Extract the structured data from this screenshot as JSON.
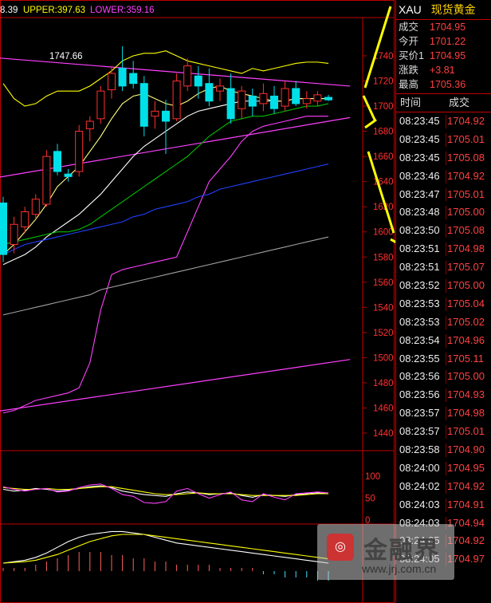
{
  "legend": {
    "mid_fragment": "8.39",
    "upper": "UPPER:397.63",
    "lower": "LOWER:359.16",
    "colors": {
      "mid": "#ffffff",
      "upper": "#ffff00",
      "lower": "#ff40ff"
    }
  },
  "annotation_high": "1747.66",
  "quote": {
    "symbol": "XAU",
    "name": "现货黄金",
    "rows": [
      {
        "label": "成交",
        "value": "1704.95",
        "color": "#ff4040"
      },
      {
        "label": "今开",
        "value": "1701.22",
        "color": "#ff4040"
      },
      {
        "label": "买价1",
        "value": "1704.95",
        "color": "#ff4040"
      },
      {
        "label": "涨跌",
        "value": "+3.81",
        "color": "#ff4040"
      },
      {
        "label": "最高",
        "value": "1705.36",
        "color": "#ff4040"
      }
    ],
    "trades_header": {
      "time": "时间",
      "price": "成交"
    },
    "trades": [
      {
        "time": "08:23:45",
        "price": "1704.92"
      },
      {
        "time": "08:23:45",
        "price": "1705.01"
      },
      {
        "time": "08:23:45",
        "price": "1705.08"
      },
      {
        "time": "08:23:46",
        "price": "1704.92"
      },
      {
        "time": "08:23:47",
        "price": "1705.01"
      },
      {
        "time": "08:23:48",
        "price": "1705.00"
      },
      {
        "time": "08:23:50",
        "price": "1705.08"
      },
      {
        "time": "08:23:51",
        "price": "1704.98"
      },
      {
        "time": "08:23:51",
        "price": "1705.07"
      },
      {
        "time": "08:23:52",
        "price": "1705.00"
      },
      {
        "time": "08:23:53",
        "price": "1705.04"
      },
      {
        "time": "08:23:53",
        "price": "1705.02"
      },
      {
        "time": "08:23:54",
        "price": "1704.96"
      },
      {
        "time": "08:23:55",
        "price": "1705.11"
      },
      {
        "time": "08:23:56",
        "price": "1705.00"
      },
      {
        "time": "08:23:56",
        "price": "1704.93"
      },
      {
        "time": "08:23:57",
        "price": "1704.98"
      },
      {
        "time": "08:23:57",
        "price": "1705.01"
      },
      {
        "time": "08:23:58",
        "price": "1704.90"
      },
      {
        "time": "08:24:00",
        "price": "1704.95"
      },
      {
        "time": "08:24:02",
        "price": "1704.92"
      },
      {
        "time": "08:24:03",
        "price": "1704.91"
      },
      {
        "time": "08:24:03",
        "price": "1704.94"
      },
      {
        "time": "08:24:05",
        "price": "1704.92"
      },
      {
        "time": "08:24:05",
        "price": "1704.97"
      }
    ]
  },
  "watermark": {
    "logo_text": "金融界",
    "url": "www.jrj.com.cn"
  },
  "chart_data": [
    {
      "type": "candlestick",
      "ylim": [
        1425,
        1745
      ],
      "yticks": [
        "1740",
        "1720",
        "1700",
        "1680",
        "1660",
        "1640",
        "1620",
        "1600",
        "1580",
        "1560",
        "1540",
        "1520",
        "1500",
        "1480",
        "1460",
        "1440"
      ],
      "grid": false,
      "candles": [
        {
          "o": 1623,
          "h": 1628,
          "l": 1576,
          "c": 1582
        },
        {
          "o": 1590,
          "h": 1612,
          "l": 1583,
          "c": 1606
        },
        {
          "o": 1604,
          "h": 1620,
          "l": 1599,
          "c": 1616
        },
        {
          "o": 1614,
          "h": 1630,
          "l": 1610,
          "c": 1626
        },
        {
          "o": 1622,
          "h": 1665,
          "l": 1620,
          "c": 1660
        },
        {
          "o": 1664,
          "h": 1670,
          "l": 1645,
          "c": 1648
        },
        {
          "o": 1646,
          "h": 1650,
          "l": 1640,
          "c": 1644
        },
        {
          "o": 1648,
          "h": 1685,
          "l": 1644,
          "c": 1680
        },
        {
          "o": 1682,
          "h": 1692,
          "l": 1672,
          "c": 1688
        },
        {
          "o": 1690,
          "h": 1716,
          "l": 1686,
          "c": 1712
        },
        {
          "o": 1713,
          "h": 1732,
          "l": 1706,
          "c": 1726
        },
        {
          "o": 1730,
          "h": 1747.66,
          "l": 1712,
          "c": 1716
        },
        {
          "o": 1726,
          "h": 1736,
          "l": 1714,
          "c": 1718
        },
        {
          "o": 1718,
          "h": 1724,
          "l": 1676,
          "c": 1684
        },
        {
          "o": 1692,
          "h": 1704,
          "l": 1682,
          "c": 1696
        },
        {
          "o": 1696,
          "h": 1705,
          "l": 1662,
          "c": 1688
        },
        {
          "o": 1690,
          "h": 1726,
          "l": 1688,
          "c": 1720
        },
        {
          "o": 1716,
          "h": 1738,
          "l": 1712,
          "c": 1732
        },
        {
          "o": 1724,
          "h": 1732,
          "l": 1706,
          "c": 1716
        },
        {
          "o": 1718,
          "h": 1730,
          "l": 1700,
          "c": 1704
        },
        {
          "o": 1712,
          "h": 1722,
          "l": 1704,
          "c": 1716
        },
        {
          "o": 1714,
          "h": 1726,
          "l": 1686,
          "c": 1690
        },
        {
          "o": 1698,
          "h": 1716,
          "l": 1690,
          "c": 1712
        },
        {
          "o": 1708,
          "h": 1714,
          "l": 1692,
          "c": 1700
        },
        {
          "o": 1702,
          "h": 1718,
          "l": 1696,
          "c": 1710
        },
        {
          "o": 1708,
          "h": 1716,
          "l": 1694,
          "c": 1698
        },
        {
          "o": 1700,
          "h": 1720,
          "l": 1696,
          "c": 1714
        },
        {
          "o": 1714,
          "h": 1720,
          "l": 1700,
          "c": 1702
        },
        {
          "o": 1702,
          "h": 1712,
          "l": 1698,
          "c": 1706
        },
        {
          "o": 1704,
          "h": 1712,
          "l": 1700,
          "c": 1709
        },
        {
          "o": 1707,
          "h": 1709,
          "l": 1704,
          "c": 1705
        }
      ],
      "overlays": [
        {
          "kind": "trendline",
          "color": "#ff40ff",
          "points": [
            [
              0,
              1738
            ],
            [
              29,
              1718
            ]
          ]
        },
        {
          "kind": "trendline",
          "color": "#ff40ff",
          "points": [
            [
              0,
              1644
            ],
            [
              30,
              1688
            ]
          ]
        },
        {
          "kind": "trendline",
          "color": "#ff40ff",
          "points": [
            [
              0,
              1458
            ],
            [
              30,
              1496
            ]
          ]
        },
        {
          "kind": "boll_upper",
          "color": "#ffff00",
          "values": [
            1718,
            1706,
            1700,
            1702,
            1708,
            1712,
            1712,
            1712,
            1716,
            1722,
            1728,
            1736,
            1740,
            1742,
            1742,
            1744,
            1740,
            1736,
            1734,
            1732,
            1730,
            1728,
            1726,
            1730,
            1728,
            1730,
            1732,
            1734,
            1735,
            1735,
            1734
          ]
        },
        {
          "kind": "boll_mid",
          "color": "#ffffff",
          "values": [
            1574,
            1578,
            1582,
            1588,
            1596,
            1602,
            1608,
            1614,
            1622,
            1630,
            1640,
            1650,
            1660,
            1668,
            1674,
            1680,
            1686,
            1692,
            1696,
            1698,
            1700,
            1702,
            1704,
            1704,
            1704,
            1704,
            1704,
            1706,
            1706,
            1706,
            1706
          ]
        },
        {
          "kind": "boll_lower",
          "color": "#ff40ff",
          "values": [
            1456,
            1458,
            1462,
            1466,
            1468,
            1470,
            1472,
            1476,
            1496,
            1538,
            1566,
            1570,
            1572,
            1574,
            1576,
            1578,
            1580,
            1600,
            1620,
            1640,
            1650,
            1660,
            1672,
            1680,
            1684,
            1686,
            1688,
            1690,
            1692,
            1692,
            1692
          ]
        },
        {
          "kind": "ma",
          "color": "#ffff80",
          "values": [
            1582,
            1590,
            1600,
            1610,
            1622,
            1636,
            1644,
            1652,
            1664,
            1676,
            1690,
            1702,
            1708,
            1710,
            1706,
            1702,
            1700,
            1704,
            1710,
            1714,
            1716,
            1712,
            1710,
            1708,
            1706,
            1704,
            1704,
            1706,
            1706,
            1706,
            1706
          ]
        },
        {
          "kind": "ma",
          "color": "#00c000",
          "values": [
            1590,
            1592,
            1594,
            1596,
            1598,
            1600,
            1600,
            1602,
            1606,
            1612,
            1618,
            1624,
            1630,
            1636,
            1642,
            1648,
            1654,
            1660,
            1668,
            1676,
            1682,
            1688,
            1690,
            1692,
            1692,
            1694,
            1696,
            1698,
            1700,
            1700,
            1702
          ]
        },
        {
          "kind": "ma",
          "color": "#2040ff",
          "values": [
            1582,
            1586,
            1590,
            1592,
            1594,
            1596,
            1598,
            1600,
            1602,
            1604,
            1606,
            1608,
            1612,
            1614,
            1618,
            1620,
            1622,
            1624,
            1628,
            1630,
            1634,
            1636,
            1638,
            1640,
            1642,
            1644,
            1646,
            1648,
            1650,
            1652,
            1654
          ]
        },
        {
          "kind": "ma",
          "color": "#a0a0a0",
          "values": [
            1534,
            1536,
            1538,
            1540,
            1542,
            1544,
            1546,
            1548,
            1550,
            1554,
            1556,
            1558,
            1560,
            1562,
            1564,
            1566,
            1568,
            1570,
            1572,
            1574,
            1576,
            1578,
            1580,
            1582,
            1584,
            1586,
            1588,
            1590,
            1592,
            1594,
            1596
          ]
        }
      ]
    },
    {
      "type": "line",
      "yticks": [
        "100",
        "50",
        "0"
      ],
      "ylim": [
        0,
        100
      ],
      "series": [
        {
          "color": "#ffffff",
          "values": [
            70,
            66,
            68,
            72,
            70,
            66,
            68,
            72,
            76,
            78,
            74,
            66,
            62,
            58,
            56,
            54,
            60,
            64,
            62,
            58,
            60,
            62,
            56,
            52,
            58,
            56,
            54,
            58,
            60,
            62,
            60
          ]
        },
        {
          "color": "#ffff00",
          "values": [
            74,
            72,
            70,
            70,
            72,
            70,
            70,
            72,
            74,
            76,
            76,
            72,
            68,
            64,
            60,
            58,
            58,
            60,
            62,
            60,
            60,
            60,
            58,
            56,
            56,
            56,
            56,
            56,
            58,
            60,
            60
          ]
        },
        {
          "color": "#ff40ff",
          "values": [
            76,
            70,
            66,
            70,
            72,
            64,
            66,
            74,
            80,
            82,
            72,
            58,
            54,
            40,
            38,
            42,
            66,
            72,
            60,
            50,
            58,
            64,
            46,
            42,
            60,
            52,
            46,
            60,
            62,
            64,
            62
          ]
        }
      ]
    },
    {
      "type": "line",
      "series": [
        {
          "color": "#ffffff",
          "values": [
            0,
            2,
            4,
            8,
            14,
            22,
            30,
            36,
            40,
            42,
            44,
            44,
            42,
            40,
            36,
            32,
            28,
            26,
            24,
            22,
            20,
            18,
            16,
            14,
            12,
            10,
            8,
            6,
            4,
            2,
            0
          ]
        },
        {
          "color": "#ffff00",
          "values": [
            0,
            1,
            2,
            4,
            8,
            12,
            18,
            24,
            30,
            34,
            38,
            40,
            40,
            40,
            38,
            36,
            34,
            32,
            30,
            28,
            26,
            24,
            22,
            20,
            18,
            16,
            14,
            12,
            10,
            8,
            6
          ]
        }
      ],
      "bars": [
        1,
        1,
        1,
        2,
        3,
        4,
        5,
        6,
        6,
        6,
        5,
        5,
        4,
        4,
        3,
        3,
        2,
        2,
        2,
        2,
        1,
        1,
        1,
        1,
        -1,
        -1,
        -2,
        -2,
        -2,
        -3,
        -3
      ]
    }
  ]
}
